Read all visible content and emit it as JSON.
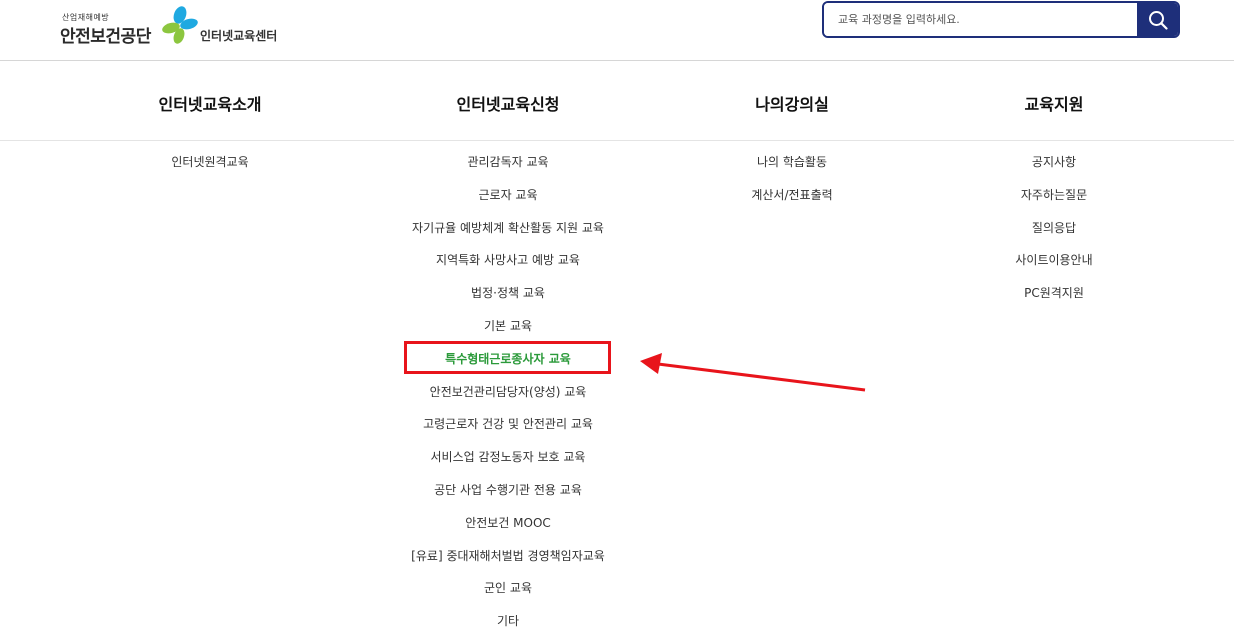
{
  "header": {
    "logo_sub": "산업재해예방",
    "logo_main": "안전보건공단",
    "center_name": "인터넷교육센터",
    "search_placeholder": "교육 과정명을 입력하세요.",
    "search_icon": "search-icon"
  },
  "nav": {
    "headings": [
      "인터넷교육소개",
      "인터넷교육신청",
      "나의강의실",
      "교육지원"
    ],
    "columns": [
      [
        "인터넷원격교육"
      ],
      [
        "관리감독자 교육",
        "근로자 교육",
        "자기규율 예방체계 확산활동 지원 교육",
        "지역특화 사망사고 예방 교육",
        "법정·정책 교육",
        "기본 교육",
        "특수형태근로종사자 교육",
        "안전보건관리담당자(양성) 교육",
        "고령근로자 건강 및 안전관리 교육",
        "서비스업 감정노동자 보호 교육",
        "공단 사업 수행기관 전용 교육",
        "안전보건 MOOC",
        "[유료] 중대재해처벌법 경영책임자교육",
        "군인 교육",
        "기타"
      ],
      [
        "나의 학습활동",
        "계산서/전표출력"
      ],
      [
        "공지사항",
        "자주하는질문",
        "질의응답",
        "사이트이용안내",
        "PC원격지원"
      ]
    ]
  },
  "highlighted_item": "특수형태근로종사자 교육",
  "colors": {
    "brand_navy": "#1e2f7a",
    "highlight_green": "#2b9a3a",
    "annotation_red": "#e8141b",
    "logo_blue": "#1fa9e1",
    "logo_green": "#8cc63f"
  }
}
